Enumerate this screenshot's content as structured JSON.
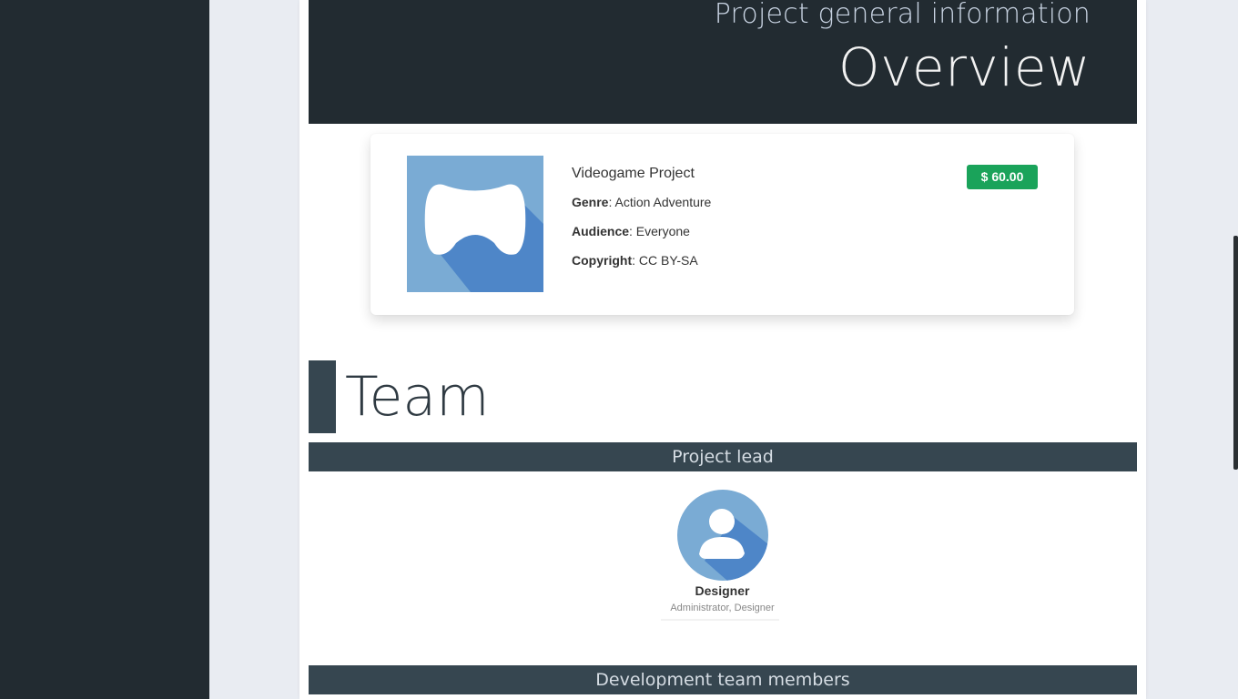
{
  "hero": {
    "subtitle": "Project general information",
    "title": "Overview"
  },
  "project": {
    "name": "Videogame Project",
    "price": "$ 60.00",
    "genre_label": "Genre",
    "genre": "Action Adventure",
    "audience_label": "Audience",
    "audience": "Everyone",
    "copyright_label": "Copyright",
    "copyright": "CC BY-SA",
    "image_icon": "gamepad-icon"
  },
  "team": {
    "title": "Team",
    "lead_header": "Project lead",
    "dev_header": "Development team members",
    "lead": {
      "name": "Designer",
      "roles": "Administrator, Designer",
      "avatar_icon": "user-avatar-icon"
    }
  },
  "colors": {
    "sidebar": "#222b31",
    "hero": "#222b31",
    "section_header": "#364650",
    "price_badge": "#1aa35a",
    "image_light": "#7aabd4",
    "image_dark": "#4e86c8"
  }
}
